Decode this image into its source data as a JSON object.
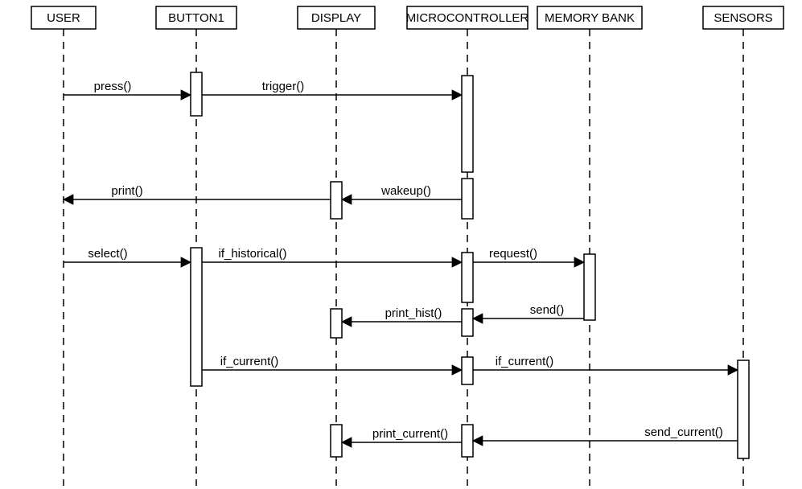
{
  "participants": [
    {
      "id": "user",
      "label": "USER"
    },
    {
      "id": "button1",
      "label": "BUTTON1"
    },
    {
      "id": "display",
      "label": "DISPLAY"
    },
    {
      "id": "mcu",
      "label": "MICROCONTROLLER"
    },
    {
      "id": "membank",
      "label": "MEMORY BANK"
    },
    {
      "id": "sensors",
      "label": "SENSORS"
    }
  ],
  "messages": {
    "press": "press()",
    "trigger": "trigger()",
    "wakeup": "wakeup()",
    "print": "print()",
    "select": "select()",
    "if_historical": "if_historical()",
    "request": "request()",
    "send": "send()",
    "print_hist": "print_hist()",
    "if_current_1": "if_current()",
    "if_current_2": "if_current()",
    "send_current": "send_current()",
    "print_current": "print_current()"
  }
}
